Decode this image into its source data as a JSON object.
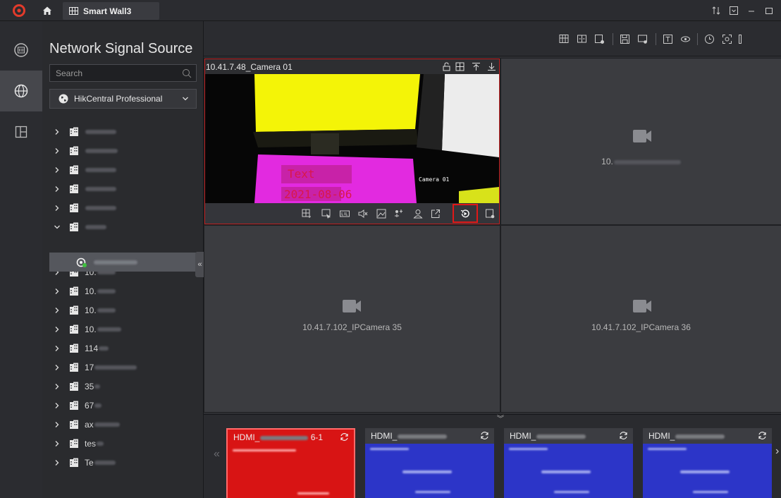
{
  "app": {
    "tab_title": "Smart Wall3"
  },
  "source_panel": {
    "title": "Network Signal Source",
    "search_placeholder": "Search",
    "selected_source": "HikCentral Professional",
    "tree": [
      {
        "label": "",
        "expanded": false
      },
      {
        "label": "",
        "expanded": false
      },
      {
        "label": "",
        "expanded": false
      },
      {
        "label": "",
        "expanded": false
      },
      {
        "label": "",
        "expanded": false
      },
      {
        "label": "",
        "expanded": true
      },
      {
        "label": "10.",
        "expanded": false
      },
      {
        "label": "10.",
        "expanded": false
      },
      {
        "label": "10.",
        "expanded": false
      },
      {
        "label": "10.",
        "expanded": false
      },
      {
        "label": "114",
        "expanded": false
      },
      {
        "label": "17",
        "expanded": false
      },
      {
        "label": "35",
        "expanded": false
      },
      {
        "label": "67",
        "expanded": false
      },
      {
        "label": "ax",
        "expanded": false
      },
      {
        "label": "tes",
        "expanded": false
      },
      {
        "label": "Te",
        "expanded": false
      }
    ]
  },
  "wall": {
    "active_window": {
      "title": "10.41.7.48_Camera 01",
      "osd_camera": "Camera 01",
      "osd_text": "Text",
      "osd_date": "2021-08-06"
    },
    "windows": [
      {
        "label": "10."
      },
      {
        "label": "10.41.7.102_IPCamera 35"
      },
      {
        "label": "10.41.7.102_IPCamera 36"
      }
    ]
  },
  "outputs": [
    {
      "label": "HDMI_",
      "suffix": "6-1",
      "selected": true
    },
    {
      "label": "HDMI_",
      "suffix": "",
      "selected": false
    },
    {
      "label": "HDMI_",
      "suffix": "",
      "selected": false
    },
    {
      "label": "HDMI_",
      "suffix": "",
      "selected": false
    }
  ],
  "colors": {
    "accent": "#d81414",
    "output_blue": "#2c35c8",
    "highlight": "#e01818"
  }
}
